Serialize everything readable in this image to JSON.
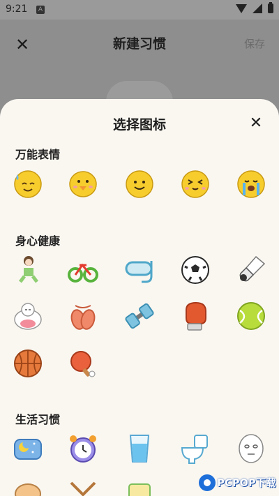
{
  "status_bar": {
    "time": "9:21",
    "notif_label": "A"
  },
  "page": {
    "title": "新建习惯",
    "save_label": "保存"
  },
  "sheet": {
    "title": "选择图标",
    "sections": [
      {
        "title": "万能表情",
        "icons": [
          "sweat-smile-face-icon",
          "chick-face-icon",
          "smile-face-icon",
          "squint-face-icon",
          "crying-face-icon"
        ]
      },
      {
        "title": "身心健康",
        "icons": [
          "running-person-icon",
          "bicycle-icon",
          "diving-mask-icon",
          "soccer-ball-icon",
          "badminton-shuttlecock-icon",
          "meditation-icon",
          "ballet-shoes-icon",
          "dumbbell-icon",
          "boxing-glove-icon",
          "tennis-ball-icon",
          "basketball-icon",
          "ping-pong-paddle-icon"
        ]
      },
      {
        "title": "生活习惯",
        "icons": [
          "sleep-pillow-icon",
          "alarm-clock-icon",
          "water-glass-icon",
          "toilet-icon",
          "face-mask-icon"
        ]
      }
    ]
  },
  "watermark": {
    "text": "PCPOP下载"
  }
}
